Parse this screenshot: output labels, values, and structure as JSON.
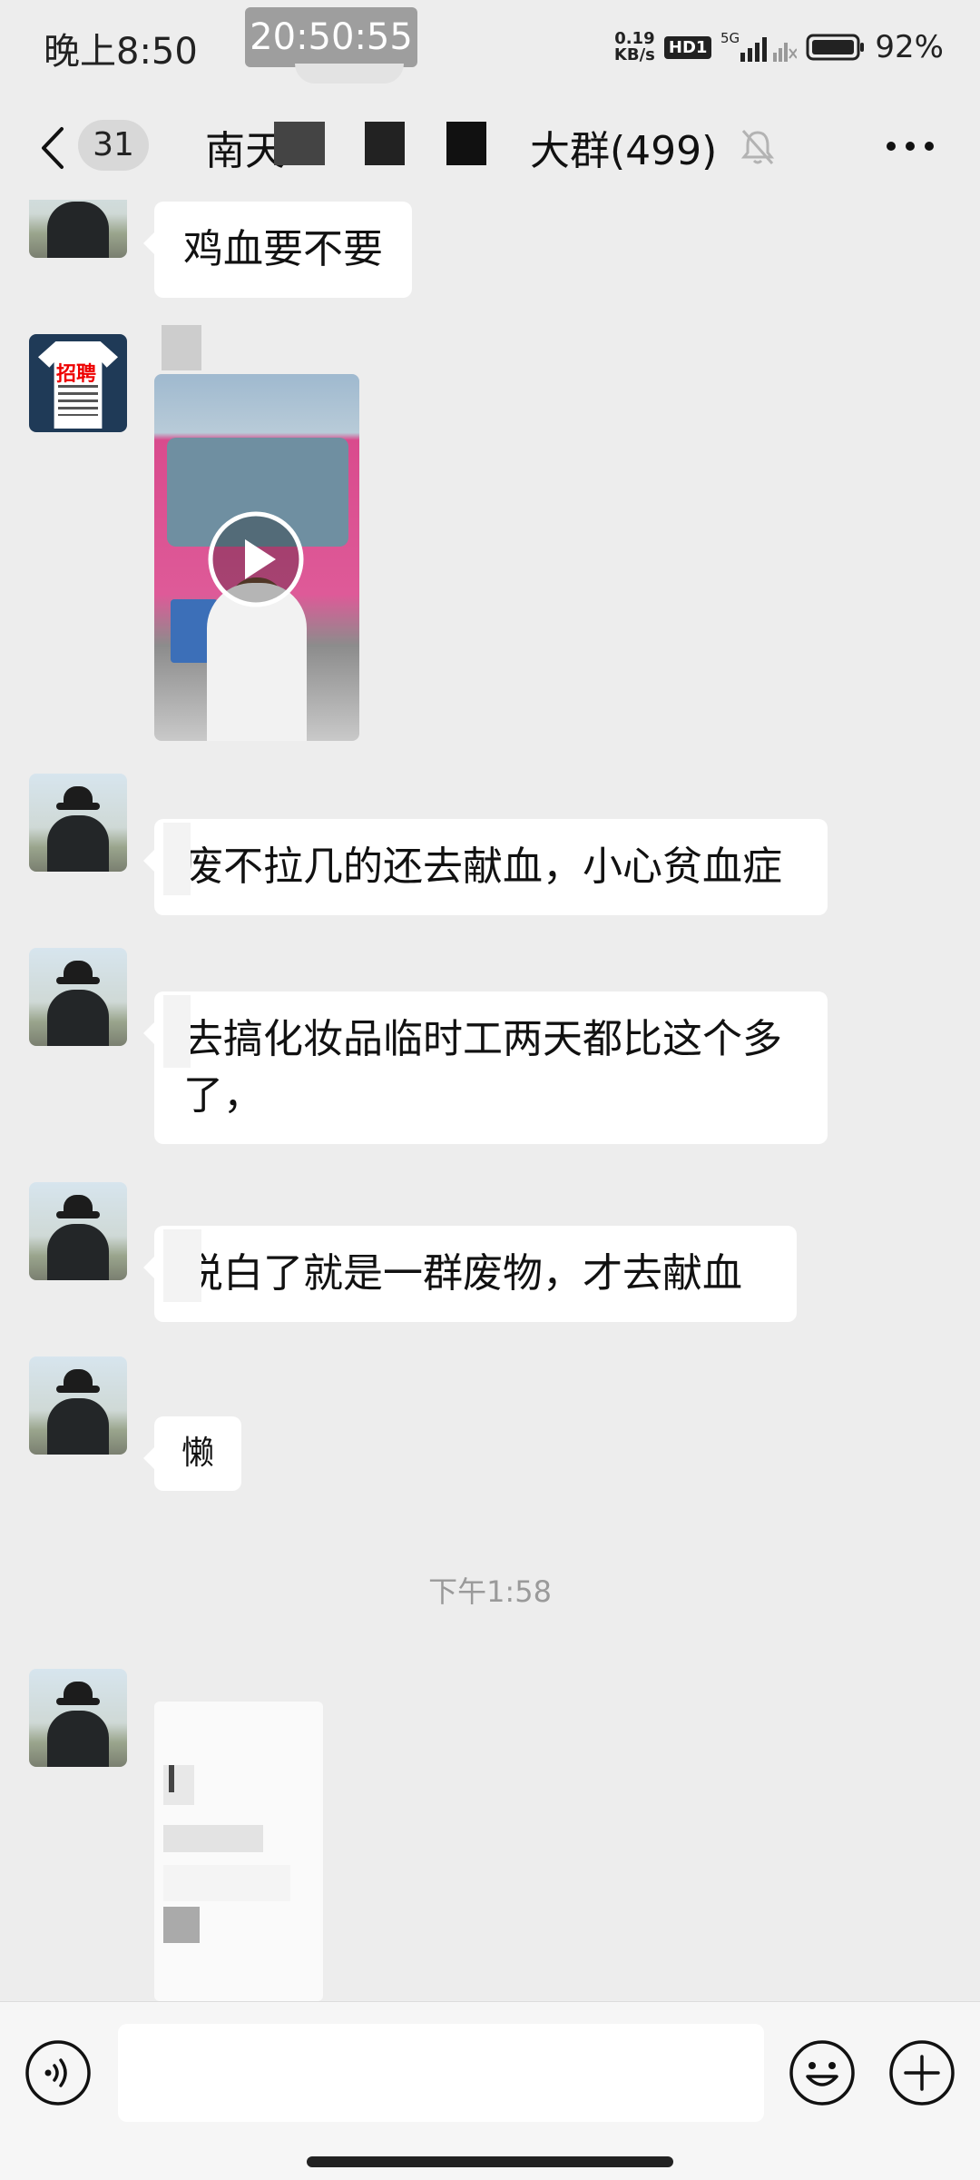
{
  "status_bar": {
    "time": "晚上8:50",
    "clock_overlay": "20:50:55",
    "net_speed_value": "0.19",
    "net_speed_unit": "KB/s",
    "hd_badge": "HD1",
    "network": "5G",
    "battery": "92%"
  },
  "header": {
    "unread_count": "31",
    "title_start": "南天",
    "title_end": "大群(499)"
  },
  "messages": [
    {
      "sender": "person-avatar",
      "type": "text",
      "text": "鸡血要不要"
    },
    {
      "sender": "recruit-avatar",
      "type": "video"
    },
    {
      "sender": "person-avatar",
      "type": "text",
      "text": "废不拉几的还去献血，小心贫血症"
    },
    {
      "sender": "person-avatar",
      "type": "text",
      "text": "去搞化妆品临时工两天都比这个多了，"
    },
    {
      "sender": "person-avatar",
      "type": "text",
      "text": "说白了就是一群废物，才去献血"
    },
    {
      "sender": "person-avatar",
      "type": "text",
      "text": "懒"
    },
    {
      "sender": "person-avatar",
      "type": "image"
    }
  ],
  "timestamp": "下午1:58",
  "recruit_avatar_text": "招聘",
  "input": {
    "value": ""
  }
}
